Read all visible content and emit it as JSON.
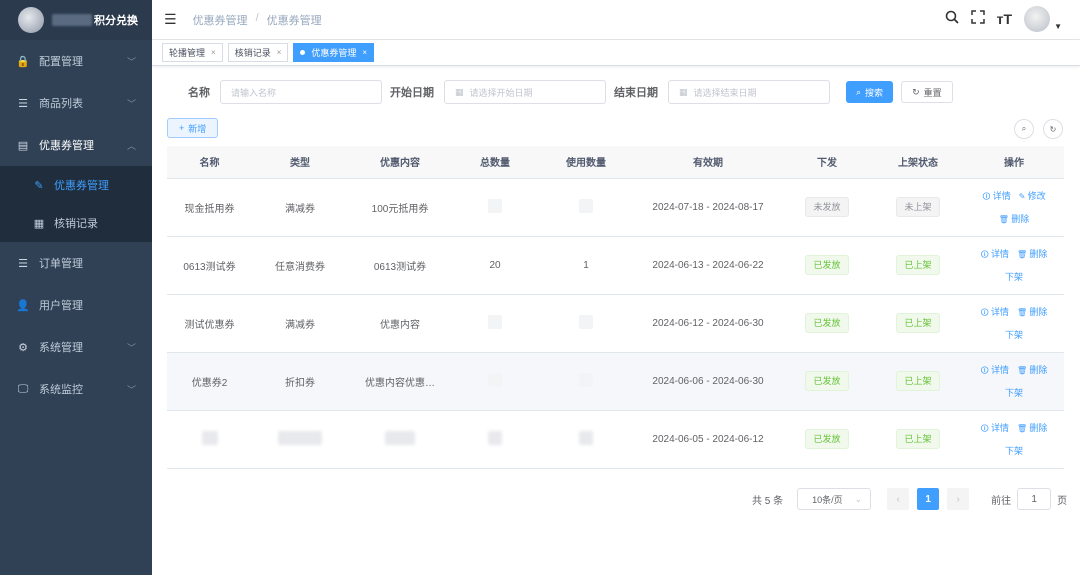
{
  "app": {
    "title_suffix": "积分兑换"
  },
  "sidebar": {
    "items": [
      {
        "label": "配置管理",
        "icon": "lock-icon",
        "glyph": "🔒",
        "has_children": true
      },
      {
        "label": "商品列表",
        "icon": "list-icon",
        "glyph": "☰",
        "has_children": true
      },
      {
        "label": "优惠券管理",
        "icon": "document-icon",
        "glyph": "▤",
        "has_children": true,
        "open": true
      },
      {
        "label": "订单管理",
        "icon": "list-icon",
        "glyph": "☰",
        "has_children": false
      },
      {
        "label": "用户管理",
        "icon": "user-icon",
        "glyph": "👤",
        "has_children": false
      },
      {
        "label": "系统管理",
        "icon": "gear-icon",
        "glyph": "⚙",
        "has_children": true
      },
      {
        "label": "系统监控",
        "icon": "monitor-icon",
        "glyph": "🖵",
        "has_children": true
      }
    ],
    "submenu": [
      {
        "label": "优惠券管理",
        "active": true
      },
      {
        "label": "核销记录",
        "active": false
      }
    ]
  },
  "header": {
    "breadcrumb": [
      "优惠券管理",
      "优惠券管理"
    ]
  },
  "tags": [
    {
      "label": "轮播管理",
      "active": false
    },
    {
      "label": "核销记录",
      "active": false
    },
    {
      "label": "优惠券管理",
      "active": true
    }
  ],
  "search": {
    "name_label": "名称",
    "name_placeholder": "请输入名称",
    "start_label": "开始日期",
    "start_placeholder": "请选择开始日期",
    "end_label": "结束日期",
    "end_placeholder": "请选择结束日期",
    "search_btn": "搜索",
    "reset_btn": "重置"
  },
  "add_btn": "新增",
  "table": {
    "columns": [
      "名称",
      "类型",
      "优惠内容",
      "总数量",
      "使用数量",
      "有效期",
      "下发",
      "上架状态",
      "操作"
    ],
    "rows": [
      {
        "name": "现金抵用券",
        "type": "满减券",
        "content": "100元抵用券",
        "total": "",
        "used": "",
        "period": "2024-07-18 - 2024-08-17",
        "issue": "未发放",
        "issue_ok": false,
        "shelf": "未上架",
        "shelf_ok": false,
        "ops": [
          "详情",
          "修改",
          "删除"
        ]
      },
      {
        "name": "0613测试券",
        "type": "任意消费券",
        "content": "0613测试券",
        "total": "20",
        "used": "1",
        "period": "2024-06-13 - 2024-06-22",
        "issue": "已发放",
        "issue_ok": true,
        "shelf": "已上架",
        "shelf_ok": true,
        "ops": [
          "详情",
          "删除",
          "下架"
        ]
      },
      {
        "name": "测试优惠券",
        "type": "满减券",
        "content": "优惠内容",
        "total": "",
        "used": "",
        "period": "2024-06-12 - 2024-06-30",
        "issue": "已发放",
        "issue_ok": true,
        "shelf": "已上架",
        "shelf_ok": true,
        "ops": [
          "详情",
          "删除",
          "下架"
        ]
      },
      {
        "name": "优惠券2",
        "type": "折扣券",
        "content": "优惠内容优惠…",
        "total": "",
        "used": "",
        "period": "2024-06-06 - 2024-06-30",
        "issue": "已发放",
        "issue_ok": true,
        "shelf": "已上架",
        "shelf_ok": true,
        "ops": [
          "详情",
          "删除",
          "下架"
        ],
        "hover": true
      },
      {
        "name": "",
        "type": "",
        "content": "",
        "total": "",
        "used": "",
        "period": "2024-06-05 - 2024-06-12",
        "issue": "已发放",
        "issue_ok": true,
        "shelf": "已上架",
        "shelf_ok": true,
        "ops": [
          "详情",
          "删除",
          "下架"
        ],
        "blurred": true
      }
    ]
  },
  "pagination": {
    "total_text": "共 5 条",
    "page_size": "10条/页",
    "current_page": "1",
    "goto_label": "前往",
    "goto_value": "1",
    "page_unit": "页"
  },
  "colors": {
    "sidebar_bg": "#304156",
    "primary": "#409eff",
    "success": "#67c23a"
  }
}
